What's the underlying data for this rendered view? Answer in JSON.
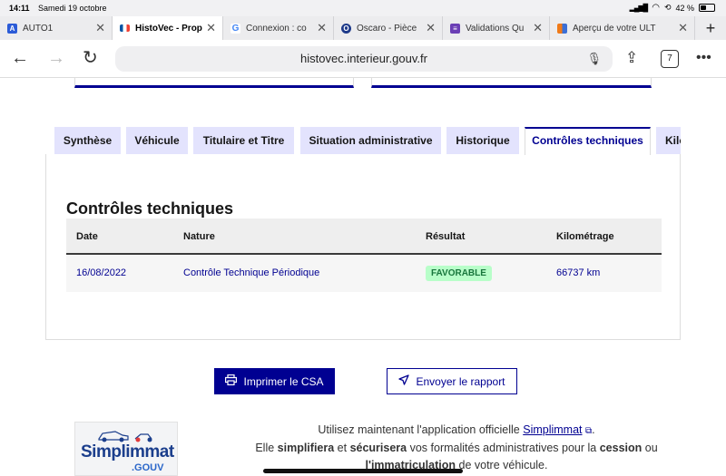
{
  "status": {
    "time": "14:11",
    "date": "Samedi 19 octobre",
    "battery": "42 %",
    "battery_level": 0.42
  },
  "browser_tabs": [
    {
      "title": "AUTO1",
      "favicon_color": "#2b5bd7",
      "favicon_glyph": "A",
      "active": false
    },
    {
      "title": "HistoVec - Prop",
      "favicon_color": "#ffffff",
      "favicon_glyph": "🇫🇷",
      "active": true
    },
    {
      "title": "Connexion : co",
      "favicon_color": "#ffffff",
      "favicon_glyph": "G",
      "active": false
    },
    {
      "title": "Oscaro - Pièce",
      "favicon_color": "#1e3a8a",
      "favicon_glyph": "O",
      "active": false
    },
    {
      "title": "Validations Qu",
      "favicon_color": "#6b3fb5",
      "favicon_glyph": "≡",
      "active": false
    },
    {
      "title": "Aperçu de votre ULT",
      "favicon_color": "#f07a18",
      "favicon_glyph": "",
      "active": false
    }
  ],
  "toolbar": {
    "url": "histovec.interieur.gouv.fr",
    "tab_count": "7"
  },
  "page_tabs": [
    {
      "label": "Synthèse",
      "active": false
    },
    {
      "label": "Véhicule",
      "active": false
    },
    {
      "label": "Titulaire et Titre",
      "active": false
    },
    {
      "label": "Situation administrative",
      "active": false
    },
    {
      "label": "Historique",
      "active": false
    },
    {
      "label": "Contrôles techniques",
      "active": true
    },
    {
      "label": "Kilométrage",
      "active": false
    }
  ],
  "section": {
    "title": "Contrôles techniques",
    "columns": [
      "Date",
      "Nature",
      "Résultat",
      "Kilométrage"
    ],
    "rows": [
      {
        "date": "16/08/2022",
        "nature": "Contrôle Technique Périodique",
        "result": "FAVORABLE",
        "km": "66737 km"
      }
    ]
  },
  "actions": {
    "print": "Imprimer le CSA",
    "send": "Envoyer le rapport"
  },
  "promo": {
    "logo_name": "Simplimmat",
    "logo_suffix": ".GOUV",
    "l1_a": "Utilisez maintenant l'application officielle ",
    "l1_link": "Simplimmat",
    "l1_end": ".",
    "l2_a": "Elle ",
    "l2_b": "simplifiera",
    "l2_c": " et ",
    "l2_d": "sécurisera",
    "l2_e": " vos formalités administratives pour la ",
    "l2_f": "cession",
    "l2_g": " ou",
    "l3_a": "l'immatriculation",
    "l3_b": " de votre véhicule."
  },
  "colors": {
    "primary": "#000091",
    "tab_bg": "#e3e3fd",
    "success_bg": "#b8fec9",
    "success_text": "#18753c"
  }
}
